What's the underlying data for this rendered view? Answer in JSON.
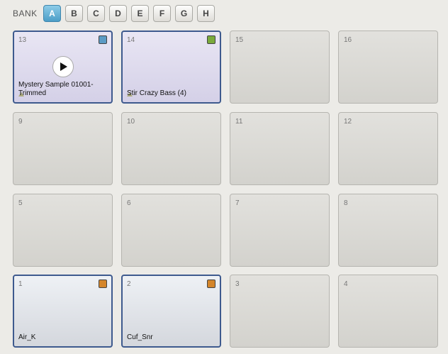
{
  "bank": {
    "label": "BANK",
    "buttons": [
      "A",
      "B",
      "C",
      "D",
      "E",
      "F",
      "G",
      "H"
    ],
    "active": "A"
  },
  "pads": {
    "p13": {
      "number": "13",
      "name": "Mystery Sample 01001-Trimmed",
      "color": "#5b9bc4"
    },
    "p14": {
      "number": "14",
      "name": "Stir Crazy Bass (4)",
      "color": "#7aaa3c"
    },
    "p15": {
      "number": "15"
    },
    "p16": {
      "number": "16"
    },
    "p9": {
      "number": "9"
    },
    "p10": {
      "number": "10"
    },
    "p11": {
      "number": "11"
    },
    "p12": {
      "number": "12"
    },
    "p5": {
      "number": "5"
    },
    "p6": {
      "number": "6"
    },
    "p7": {
      "number": "7"
    },
    "p8": {
      "number": "8"
    },
    "p1": {
      "number": "1",
      "name": "Air_K",
      "color": "#d4852a"
    },
    "p2": {
      "number": "2",
      "name": "Cuf_Snr",
      "color": "#d4852a"
    },
    "p3": {
      "number": "3"
    },
    "p4": {
      "number": "4"
    }
  },
  "icons": {
    "play": "play-icon"
  }
}
